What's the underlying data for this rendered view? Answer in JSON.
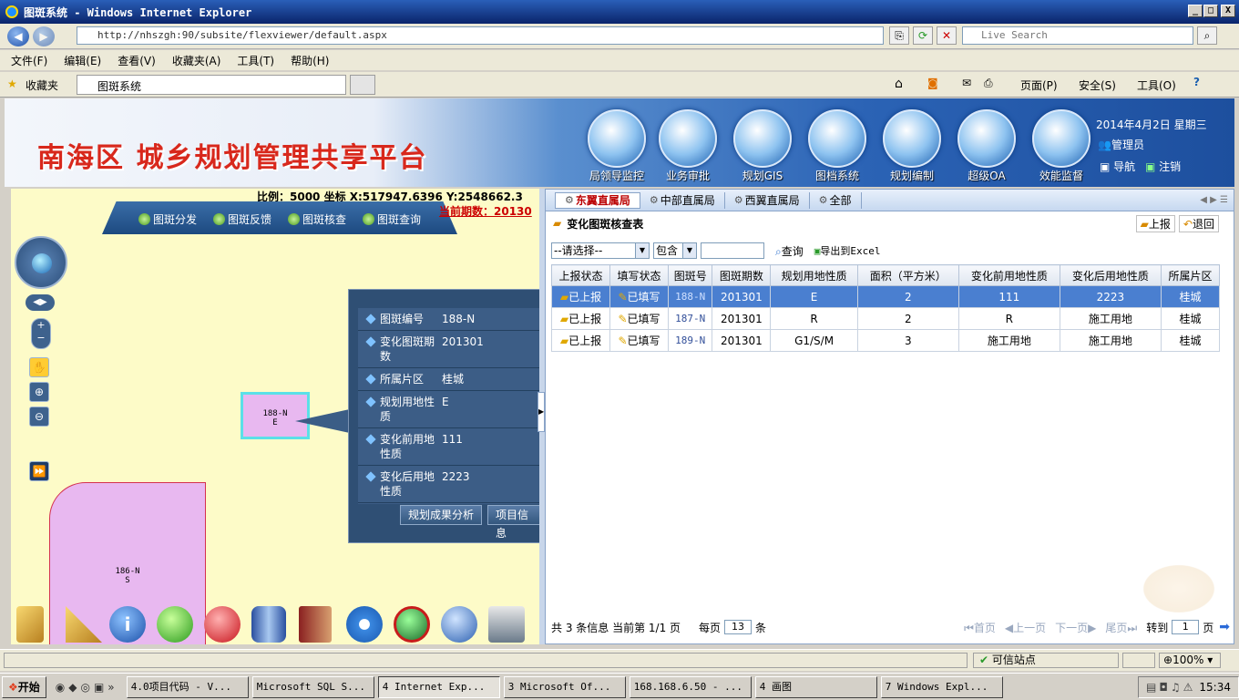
{
  "window": {
    "title": "图斑系统 - Windows Internet Explorer",
    "min": "_",
    "max": "□",
    "close": "X"
  },
  "addressbar": {
    "url": "http://nhszgh:90/subsite/flexviewer/default.aspx",
    "search_placeholder": "Live Search"
  },
  "menubar": [
    "文件(F)",
    "编辑(E)",
    "查看(V)",
    "收藏夹(A)",
    "工具(T)",
    "帮助(H)"
  ],
  "favorites": {
    "label": "收藏夹",
    "tab_title": "图斑系统",
    "tools": [
      "页面(P)",
      "安全(S)",
      "工具(O)"
    ]
  },
  "banner": {
    "title": "南海区 城乡规划管理共享平台",
    "nav": [
      "局领导监控",
      "业务审批",
      "规划GIS",
      "图档系统",
      "规划编制",
      "超级OA",
      "效能监督"
    ],
    "date": "2014年4月2日 星期三",
    "user": "管理员",
    "links": [
      "导航",
      "注销"
    ]
  },
  "map": {
    "scale_text": "比例：5000 坐标 X:517947.6396 Y:2548662.3",
    "period_text": "当前期数：20130",
    "tabs": [
      "图斑分发",
      "图斑反馈",
      "图斑核查",
      "图斑查询"
    ],
    "parcels": [
      {
        "label1": "188-N",
        "label2": "E"
      },
      {
        "label1": "186-N",
        "label2": "S"
      }
    ],
    "popup": {
      "rows": [
        {
          "k": "图斑编号",
          "v": "188-N"
        },
        {
          "k": "变化图斑期数",
          "v": "201301"
        },
        {
          "k": "所属片区",
          "v": "桂城"
        },
        {
          "k": "规划用地性质",
          "v": "E"
        },
        {
          "k": "变化前用地性质",
          "v": "111"
        },
        {
          "k": "变化后用地性质",
          "v": "2223"
        }
      ],
      "buttons": [
        "规划成果分析",
        "项目信息"
      ]
    }
  },
  "panel": {
    "tabs": [
      "东翼直属局",
      "中部直属局",
      "西翼直属局",
      "全部"
    ],
    "title": "变化图斑核查表",
    "actions": [
      "上报",
      "退回"
    ],
    "filter": {
      "select": "--请选择--",
      "op": "包含",
      "value": "",
      "query": "查询",
      "export": "导出到Excel"
    },
    "columns": [
      "上报状态",
      "填写状态",
      "图斑号",
      "图斑期数",
      "规划用地性质",
      "面积（平方米）",
      "变化前用地性质",
      "变化后用地性质",
      "所属片区"
    ],
    "rows": [
      [
        "已上报",
        "已填写",
        "188-N",
        "201301",
        "E",
        "2",
        "111",
        "2223",
        "桂城"
      ],
      [
        "已上报",
        "已填写",
        "187-N",
        "201301",
        "R",
        "2",
        "R",
        "施工用地",
        "桂城"
      ],
      [
        "已上报",
        "已填写",
        "189-N",
        "201301",
        "G1/S/M",
        "3",
        "施工用地",
        "施工用地",
        "桂城"
      ]
    ],
    "footer": {
      "info": "共 3 条信息 当前第 1/1 页",
      "per_page_label": "每页",
      "per_page": "13",
      "per_page_unit": "条",
      "first": "首页",
      "prev": "上一页",
      "next": "下一页",
      "last": "尾页",
      "goto": "转到",
      "page": "1",
      "page_unit": "页"
    }
  },
  "statusbar": {
    "zone": "可信站点",
    "zoom": "100%"
  },
  "taskbar": {
    "start": "开始",
    "tasks": [
      "4.0项目代码 - V...",
      "Microsoft SQL S...",
      "4 Internet Exp...",
      "3 Microsoft Of...",
      "168.168.6.50 - ...",
      "4 画图",
      "7 Windows Expl..."
    ],
    "clock": "15:34"
  }
}
